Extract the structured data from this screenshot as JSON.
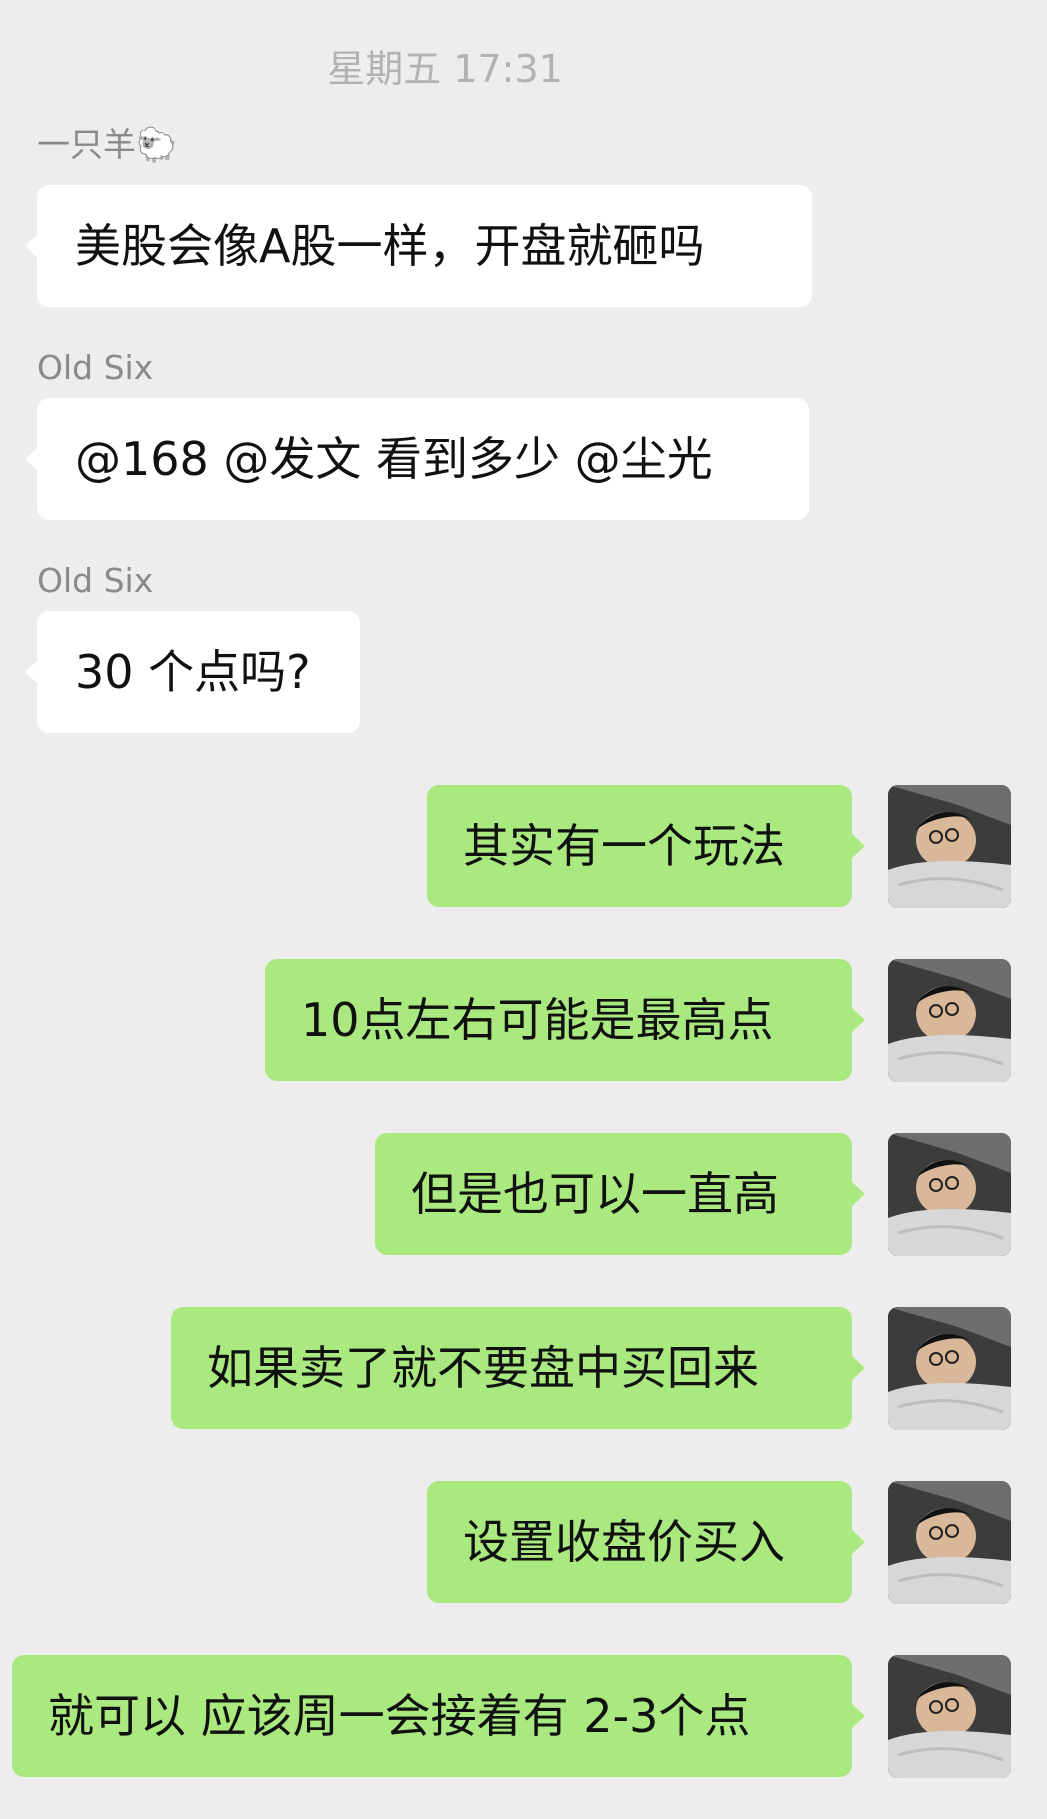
{
  "timestamp": "星期五 17:31",
  "messages": [
    {
      "sender": "一只羊🐑",
      "text": "美股会像A股一样，开盘就砸吗",
      "side": "left"
    },
    {
      "sender": "Old Six",
      "text": "@168 @发文 看到多少  @尘光",
      "side": "left"
    },
    {
      "sender": "Old Six",
      "text": "30 个点吗?",
      "side": "left"
    },
    {
      "text": "其实有一个玩法",
      "side": "right"
    },
    {
      "text": "10点左右可能是最高点",
      "side": "right"
    },
    {
      "text": "但是也可以一直高",
      "side": "right"
    },
    {
      "text": "如果卖了就不要盘中买回来",
      "side": "right"
    },
    {
      "text": "设置收盘价买入",
      "side": "right"
    },
    {
      "text": "就可以 应该周一会接着有 2-3个点",
      "side": "right"
    }
  ],
  "colors": {
    "background": "#ededed",
    "incoming_bubble": "#ffffff",
    "outgoing_bubble": "#a9e97f",
    "sender_name": "#8a8a8a",
    "timestamp": "#b2b2b2"
  },
  "icons": {
    "avatar": "user-avatar-icon"
  }
}
